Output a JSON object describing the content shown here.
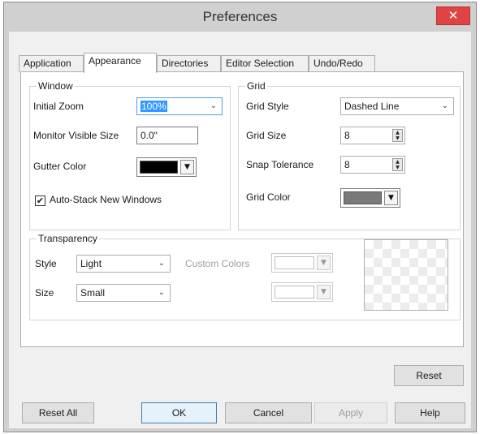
{
  "window": {
    "title": "Preferences",
    "close_glyph": "✕"
  },
  "tabs": [
    {
      "label": "Application"
    },
    {
      "label": "Appearance",
      "active": true
    },
    {
      "label": "Directories"
    },
    {
      "label": "Editor Selection"
    },
    {
      "label": "Undo/Redo"
    }
  ],
  "window_group": {
    "legend": "Window",
    "initial_zoom_label": "Initial Zoom",
    "initial_zoom_value": "100%",
    "monitor_size_label": "Monitor Visible Size",
    "monitor_size_value": "0.0\"",
    "gutter_color_label": "Gutter Color",
    "gutter_color": "#000000",
    "auto_stack_label": "Auto-Stack New Windows",
    "auto_stack_checked": true,
    "check_glyph": "✔"
  },
  "grid_group": {
    "legend": "Grid",
    "style_label": "Grid Style",
    "style_value": "Dashed Line",
    "size_label": "Grid Size",
    "size_value": "8",
    "snap_label": "Snap Tolerance",
    "snap_value": "8",
    "color_label": "Grid Color",
    "grid_color": "#7a7a7a"
  },
  "transparency_group": {
    "legend": "Transparency",
    "style_label": "Style",
    "style_value": "Light",
    "size_label": "Size",
    "size_value": "Small",
    "custom_colors_label": "Custom Colors"
  },
  "icons": {
    "chevron": "⌄",
    "dropdown_arrow": "▼",
    "spin_up": "▲",
    "spin_down": "▼"
  },
  "buttons": {
    "reset": "Reset",
    "reset_all": "Reset All",
    "ok": "OK",
    "cancel": "Cancel",
    "apply": "Apply",
    "help": "Help"
  }
}
